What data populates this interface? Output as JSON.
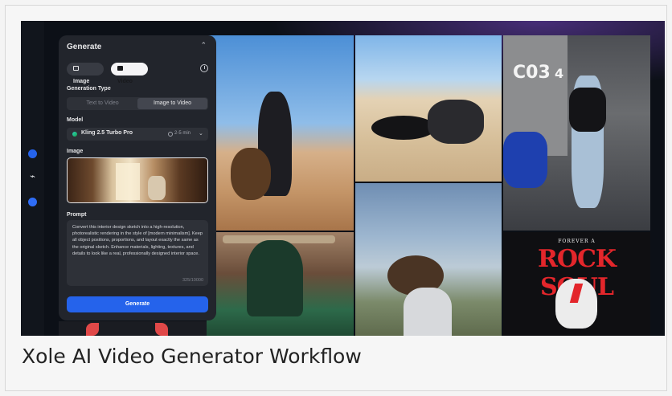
{
  "panel": {
    "title": "Generate",
    "modes": {
      "image": "Image",
      "video": "Video"
    },
    "generation_type": {
      "label": "Generation Type",
      "options": [
        "Text to Video",
        "Image to Video"
      ],
      "selected": "Image to Video"
    },
    "model": {
      "label": "Model",
      "name": "Kling 2.5 Turbo Pro",
      "time": "2-5 min"
    },
    "image_label": "Image",
    "prompt": {
      "label": "Prompt",
      "text": "Convert this interior design sketch into a high-resolution, photorealistic rendering in the style of [modern minimalism]. Keep all object positions, proportions, and layout exactly the same as the original sketch. Enhance materials, lighting, textures, and details to look like a real, professionally designed interior space.",
      "count": "325/10000"
    },
    "generate_button": "Generate"
  },
  "gallery": {
    "sign_text": "C03",
    "sign_number": "4",
    "poster_top": "FOREVER A",
    "poster_main": "ROCK SOUL"
  },
  "caption": "Xole AI Video Generator Workflow",
  "colors": {
    "accent": "#2563eb",
    "panel": "#22252c",
    "poster_red": "#e3262b"
  },
  "icons": [
    "chevron-up-icon",
    "image-icon",
    "video-icon",
    "history-icon",
    "model-icon",
    "clock-icon",
    "chevron-down-icon"
  ]
}
